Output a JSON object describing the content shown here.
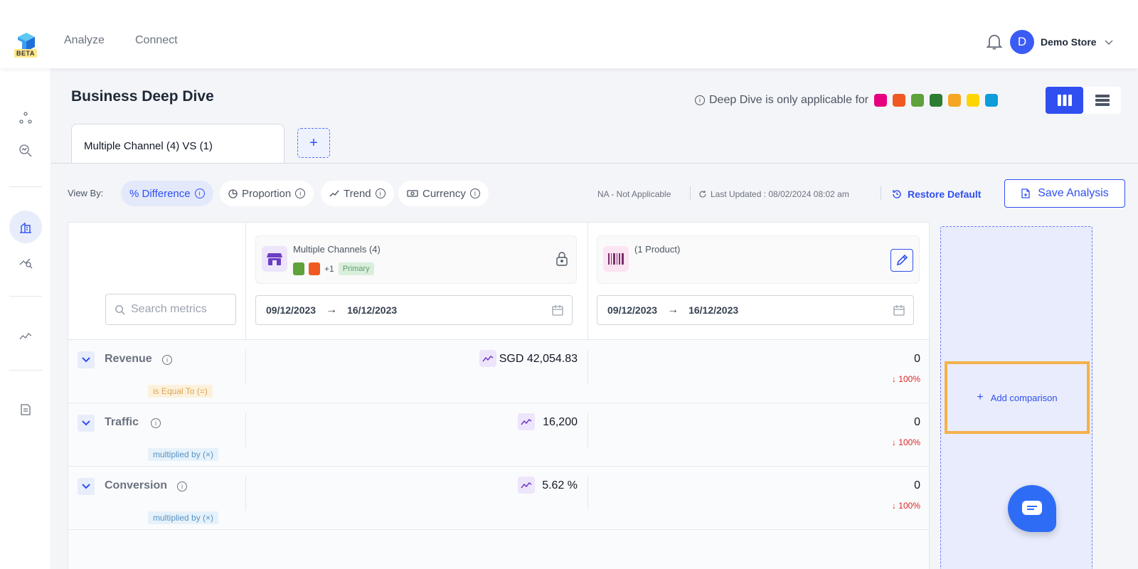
{
  "app": {
    "logo_badge": "BETA",
    "nav": [
      {
        "label": "Analyze"
      },
      {
        "label": "Connect"
      }
    ],
    "user": {
      "initial": "D",
      "store": "Demo Store"
    }
  },
  "page": {
    "title": "Business Deep Dive",
    "note": "Deep Dive is only applicable for",
    "note_brands": [
      "#e6007e",
      "#f05a22",
      "#5fa13a",
      "#2e7d32",
      "#f5a623",
      "#ffd500",
      "#0d9dda"
    ]
  },
  "tabs": {
    "active_label": "Multiple Channel (4) VS (1)",
    "add_label": "+"
  },
  "toolbar": {
    "view_by_label": "View By:",
    "chips": [
      {
        "label": "% Difference"
      },
      {
        "label": "Proportion"
      },
      {
        "label": "Trend"
      },
      {
        "label": "Currency"
      }
    ],
    "na_text": "NA - Not Applicable",
    "last_updated": "Last Updated : 08/02/2024 08:02 am",
    "restore_label": "Restore Default",
    "save_label": "Save Analysis"
  },
  "table": {
    "search_placeholder": "Search metrics",
    "primary": {
      "title": "Multiple Channels (4)",
      "extra_count": "+1",
      "badge": "Primary",
      "date_from": "09/12/2023",
      "date_to": "16/12/2023"
    },
    "secondary": {
      "title": "(1 Product)",
      "date_from": "09/12/2023",
      "date_to": "16/12/2023"
    },
    "arrow": "→",
    "rows": [
      {
        "name": "Revenue",
        "value": "SGD 42,054.83",
        "compare": "0",
        "pct": "100%"
      },
      {
        "name": "Traffic",
        "value": "16,200",
        "compare": "0",
        "pct": "100%"
      },
      {
        "name": "Conversion",
        "value": "5.62 %",
        "compare": "0",
        "pct": "100%"
      }
    ],
    "operators": [
      "is Equal To (=)",
      "multiplied by (×)",
      "multiplied by (×)"
    ]
  },
  "comparison": {
    "add_label": "Add comparison"
  }
}
